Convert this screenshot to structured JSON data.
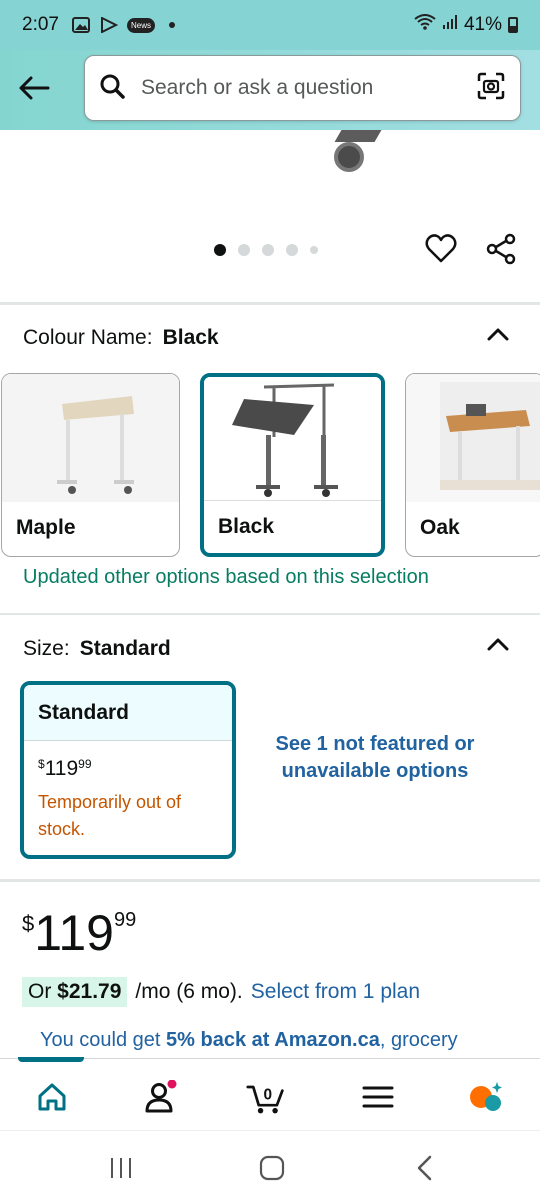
{
  "status": {
    "time": "2:07",
    "battery": "41%",
    "news_badge": "News"
  },
  "search": {
    "placeholder": "Search or ask a question"
  },
  "carousel": {
    "dot_count": 5,
    "active_index": 0
  },
  "colour": {
    "label": "Colour Name:",
    "value": "Black",
    "options": [
      {
        "name": "Maple",
        "selected": false
      },
      {
        "name": "Black",
        "selected": true
      },
      {
        "name": "Oak",
        "selected": false
      }
    ],
    "note": "Updated other options based on this selection"
  },
  "size": {
    "label": "Size:",
    "value": "Standard",
    "card": {
      "title": "Standard",
      "price_symbol": "$",
      "price_whole": "119",
      "price_fraction": "99",
      "stock_status": "Temporarily out of stock."
    },
    "see_more": "See 1 not featured or unavailable options"
  },
  "price": {
    "symbol": "$",
    "whole": "119",
    "fraction": "99"
  },
  "installment": {
    "prefix": "Or",
    "amount": "$21.79",
    "suffix": "/mo (6 mo).",
    "link": "Select from 1 plan"
  },
  "promo": {
    "pre": "You could get",
    "highlight": "5% back at Amazon.ca",
    "post": ", grocery"
  },
  "nav": {
    "cart_count": "0"
  },
  "colors": {
    "accent": "#007185",
    "link": "#2162a1",
    "success": "#067d62",
    "warning": "#c45500",
    "header": "#86d3d4"
  }
}
